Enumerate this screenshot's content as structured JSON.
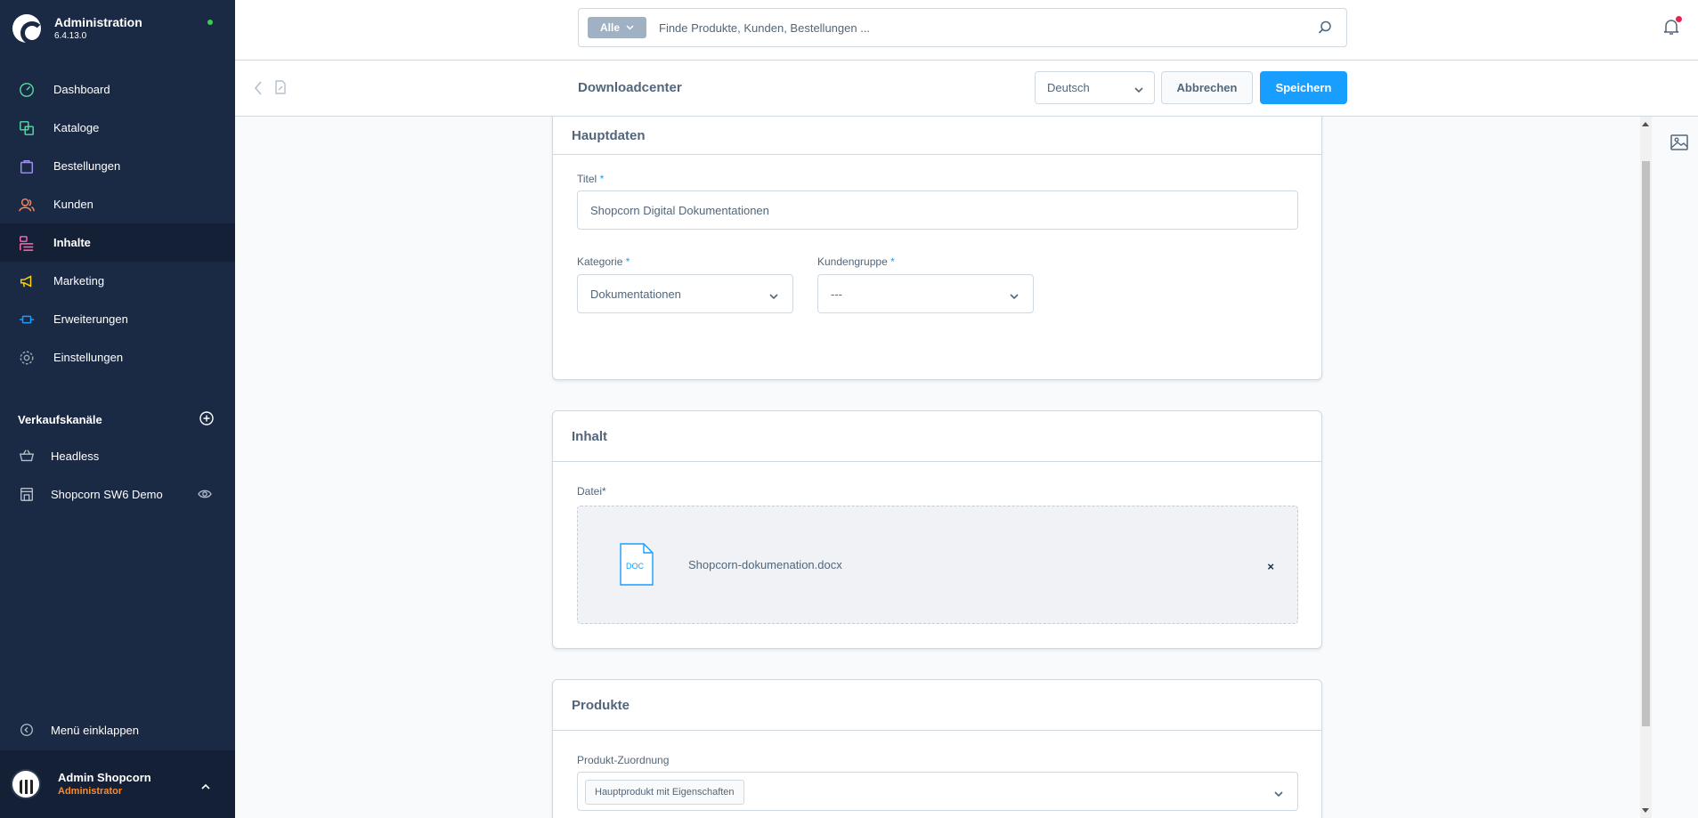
{
  "brand": {
    "title": "Administration",
    "version": "6.4.13.0"
  },
  "nav": [
    {
      "label": "Dashboard",
      "icon": "dashboard-icon",
      "color": "#57d9a3"
    },
    {
      "label": "Kataloge",
      "icon": "catalog-icon",
      "color": "#57d9a3"
    },
    {
      "label": "Bestellungen",
      "icon": "orders-icon",
      "color": "#a092f0"
    },
    {
      "label": "Kunden",
      "icon": "customers-icon",
      "color": "#f88962"
    },
    {
      "label": "Inhalte",
      "icon": "content-icon",
      "color": "#ff68b4"
    },
    {
      "label": "Marketing",
      "icon": "marketing-icon",
      "color": "#ffd700"
    },
    {
      "label": "Erweiterungen",
      "icon": "extensions-icon",
      "color": "#189eff"
    },
    {
      "label": "Einstellungen",
      "icon": "settings-icon",
      "color": "#9aa8b5"
    }
  ],
  "sales_channels": {
    "title": "Verkaufskanäle",
    "items": [
      {
        "label": "Headless"
      },
      {
        "label": "Shopcorn SW6 Demo"
      }
    ]
  },
  "collapse_label": "Menü einklappen",
  "user": {
    "name": "Admin Shopcorn",
    "role": "Administrator"
  },
  "search": {
    "type_label": "Alle",
    "placeholder": "Finde Produkte, Kunden, Bestellungen ..."
  },
  "smartbar": {
    "title": "Downloadcenter",
    "language": "Deutsch",
    "cancel_label": "Abbrechen",
    "save_label": "Speichern"
  },
  "hauptdaten": {
    "title": "Hauptdaten",
    "titel_label": "Titel",
    "titel_value": "Shopcorn Digital Dokumentationen",
    "kategorie_label": "Kategorie",
    "kategorie_value": "Dokumentationen",
    "kundengruppe_label": "Kundengruppe",
    "kundengruppe_value": "---"
  },
  "inhalt": {
    "title": "Inhalt",
    "datei_label": "Datei*",
    "file_name": "Shopcorn-dokumenation.docx",
    "file_type": "DOC",
    "remove_symbol": "×"
  },
  "produkte": {
    "title": "Produkte",
    "zuordnung_label": "Produkt-Zuordnung",
    "tag": "Hauptprodukt mit Eigenschaften"
  },
  "required_mark": "*",
  "colors": {
    "sidebar": "#1b2a44",
    "accent": "#189eff",
    "role": "#f98b2b",
    "status": "#37d046"
  }
}
